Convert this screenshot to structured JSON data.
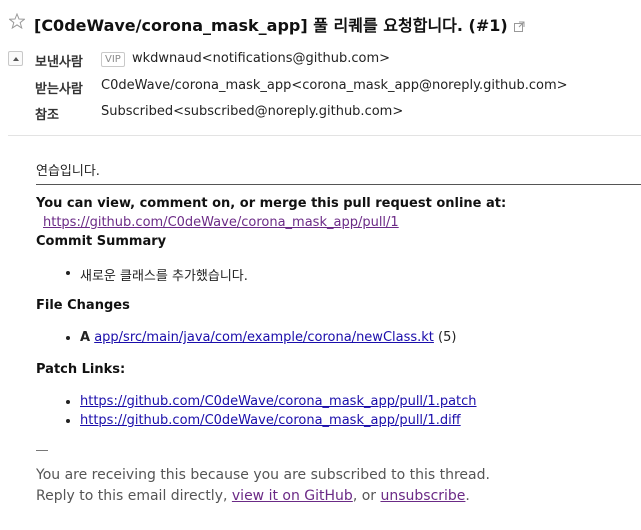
{
  "header": {
    "subject": "[C0deWave/corona_mask_app] 풀 리퀘를 요청합니다. (#1)"
  },
  "meta": {
    "from_label": "보낸사람",
    "vip_badge": "VIP",
    "from_value": "wkdwnaud<notifications@github.com>",
    "to_label": "받는사람",
    "to_value": "C0deWave/corona_mask_app<corona_mask_app@noreply.github.com>",
    "cc_label": "참조",
    "cc_value": "Subscribed<subscribed@noreply.github.com>"
  },
  "body": {
    "intro": "연습입니다.",
    "view_text": "You can view, comment on, or merge this pull request online at:",
    "pr_link": "https://github.com/C0deWave/corona_mask_app/pull/1",
    "commit_summary_heading": "Commit Summary",
    "commit_items": [
      "새로운 클래스를 추가했습니다."
    ],
    "file_changes_heading": "File Changes",
    "file_change": {
      "status": "A",
      "path": "app/src/main/java/com/example/corona/newClass.kt",
      "count": "(5)"
    },
    "patch_links_heading": "Patch Links:",
    "patch_links": [
      "https://github.com/C0deWave/corona_mask_app/pull/1.patch",
      "https://github.com/C0deWave/corona_mask_app/pull/1.diff"
    ]
  },
  "footer": {
    "line1": "You are receiving this because you are subscribed to this thread.",
    "line2_prefix": "Reply to this email directly, ",
    "view_link": "view it on GitHub",
    "line2_middle": ", or ",
    "unsubscribe_link": "unsubscribe",
    "line2_suffix": "."
  }
}
